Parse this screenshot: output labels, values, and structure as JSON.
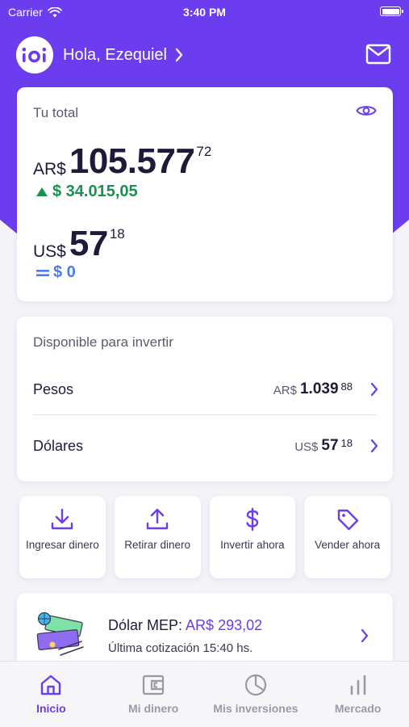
{
  "status_bar": {
    "carrier": "Carrier",
    "time": "3:40 PM"
  },
  "header": {
    "logo_text": "ioi",
    "greeting": "Hola, Ezequiel"
  },
  "total": {
    "title": "Tu total",
    "ars": {
      "currency": "AR$",
      "integer": "105.577",
      "decimals": "72",
      "change": "$ 34.015,05"
    },
    "usd": {
      "currency": "US$",
      "integer": "57",
      "decimals": "18",
      "change": "$ 0"
    }
  },
  "available": {
    "title": "Disponible para invertir",
    "rows": [
      {
        "name": "Pesos",
        "currency": "AR$",
        "integer": "1.039",
        "decimals": "88"
      },
      {
        "name": "Dólares",
        "currency": "US$",
        "integer": "57",
        "decimals": "18"
      }
    ]
  },
  "actions": [
    {
      "label": "Ingresar dinero",
      "icon": "download-icon"
    },
    {
      "label": "Retirar dinero",
      "icon": "upload-icon"
    },
    {
      "label": "Invertir ahora",
      "icon": "dollar-icon"
    },
    {
      "label": "Vender ahora",
      "icon": "tag-icon"
    }
  ],
  "mep": {
    "label": "Dólar MEP:",
    "value": "AR$ 293,02",
    "subtitle": "Última cotización 15:40 hs."
  },
  "tabs": [
    {
      "label": "Inicio",
      "icon": "home-icon",
      "active": true
    },
    {
      "label": "Mi dinero",
      "icon": "wallet-icon",
      "active": false
    },
    {
      "label": "Mis inversiones",
      "icon": "pie-chart-icon",
      "active": false
    },
    {
      "label": "Mercado",
      "icon": "bar-chart-icon",
      "active": false
    }
  ],
  "colors": {
    "primary": "#6b3dee",
    "positive": "#1a9150",
    "neutral_change": "#4a7cf0",
    "background": "#f4f3f8"
  }
}
